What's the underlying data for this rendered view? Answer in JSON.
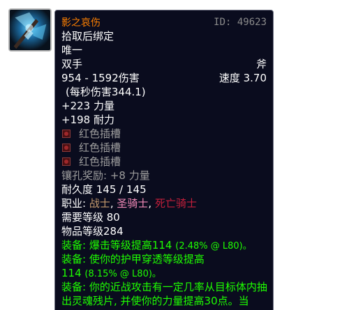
{
  "item": {
    "name": "影之哀伤",
    "id_text": "ID: 49623",
    "bind": "拾取后绑定",
    "unique": "唯一",
    "slot": "双手",
    "type": "斧",
    "damage": "954 - 1592伤害",
    "speed": "速度 3.70",
    "dps": "(每秒伤害344.1)",
    "stats": [
      "+223 力量",
      "+198 耐力"
    ],
    "sockets": [
      "红色插槽",
      "红色插槽",
      "红色插槽"
    ],
    "socket_bonus": "镶孔奖励: +8 力量",
    "durability": "耐久度 145 / 145",
    "classes_label": "职业: ",
    "classes": [
      "战士",
      "圣骑士",
      "死亡骑士"
    ],
    "class_separator": ", ",
    "required_level": "需要等级 80",
    "item_level": "物品等级284",
    "equip_effects": [
      {
        "prefix": "装备: ",
        "text": "爆击等级提高114",
        "note": "(2.48% @ L80)。"
      },
      {
        "prefix": "装备: ",
        "text": "使你的护甲穿透等级提高",
        "text2": "114",
        "note": "(8.15% @ L80)。"
      },
      {
        "prefix": "装备: ",
        "text": "你的近战攻击有一定几率从目标体内抽出灵魂残片, 并使你的力量提高30点。当"
      }
    ]
  },
  "colors": {
    "tooltip_bg": "#0a0c1e",
    "legendary": "#ff8000",
    "equip_green": "#1eff00",
    "warrior": "#c79c6e",
    "paladin": "#f58cba",
    "death_knight": "#c41f3b"
  },
  "icons": {
    "item_icon": "axe-icon",
    "socket_icon": "red-socket-icon"
  }
}
